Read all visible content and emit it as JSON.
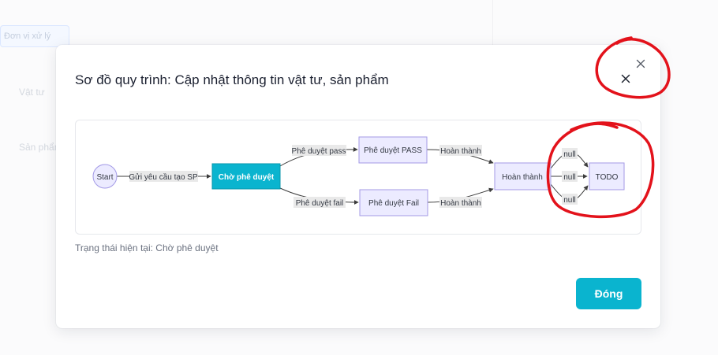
{
  "background": {
    "field_text": "Đơn vị xử lý",
    "row_1": "Vật tư",
    "row_2": "Sản phẩm"
  },
  "modal": {
    "title": "Sơ đồ quy trình: Cập nhật thông tin vật tư, sản phẩm",
    "close_icon": "close-icon",
    "status_text": "Trạng thái hiện tại: Chờ phê duyệt",
    "close_button_label": "Đóng"
  },
  "diagram": {
    "nodes": {
      "start": "Start",
      "pending": "Chờ phê duyệt",
      "pass": "Phê duyệt PASS",
      "fail": "Phê duyệt Fail",
      "done": "Hoàn thành",
      "todo": "TODO"
    },
    "edges": {
      "submit": "Gửi yêu cầu tạo SP",
      "approve_pass": "Phê duyệt pass",
      "approve_fail": "Phê duyệt fail",
      "pass_done": "Hoàn thành",
      "fail_done": "Hoàn thành",
      "null_top": "null",
      "null_mid": "null",
      "null_bottom": "null"
    }
  },
  "colors": {
    "accent": "#0ab4cf",
    "node_fill": "#ecebff",
    "node_stroke": "#a39ae6",
    "annotation_red": "#e3121b"
  }
}
